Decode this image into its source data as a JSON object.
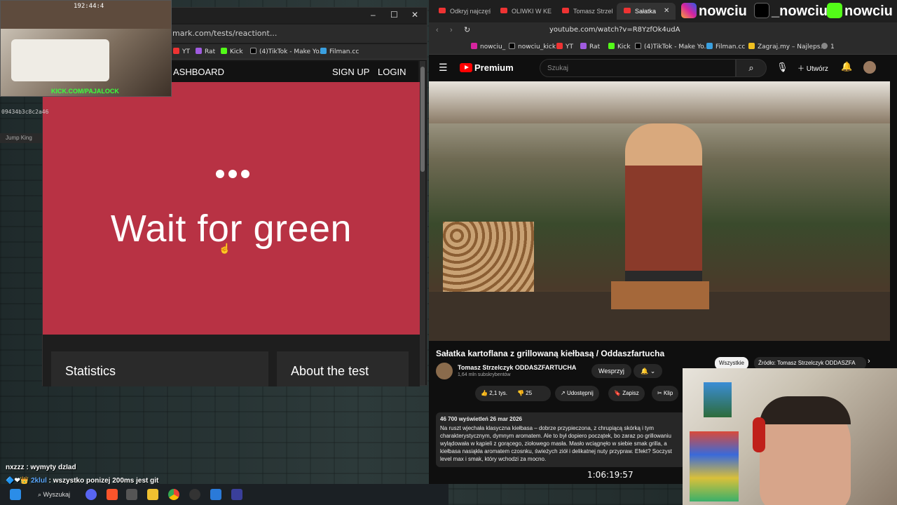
{
  "left_browser": {
    "url": "mark.com/tests/reactiont...",
    "bookmarks": [
      "YT",
      "Rat",
      "Kick",
      "(4)TikTok - Make Yo...",
      "Filman.cc"
    ],
    "nav": {
      "dashboard": "ASHBOARD",
      "signup": "SIGN UP",
      "login": "LOGIN"
    },
    "test": {
      "message": "Wait for green",
      "bg_color": "#b83244"
    },
    "cards": {
      "statistics": "Statistics",
      "about": "About the test"
    }
  },
  "stream_overlay": {
    "time": "192:44:4",
    "kick_label": "KICK.COM/PAJALOCK",
    "hash": "09434b3c8c2a46",
    "jump_king": "Jump King"
  },
  "right_browser": {
    "tabs": [
      "Odkryj najczęśc",
      "OLIWKI W KE",
      "Tomasz Strzel",
      "Sałatka"
    ],
    "social": {
      "instagram": "nowciu",
      "x": "_nowciu",
      "kick": "nowciu"
    },
    "url": "youtube.com/watch?v=R8YzfOk4udA",
    "bookmarks": [
      "nowciu_",
      "nowciu_kick",
      "YT",
      "Rat",
      "Kick",
      "(4)TikTok - Make Yo...",
      "Filman.cc",
      "Zagraj.my – Najleps...",
      "1"
    ],
    "youtube": {
      "logo": "Premium",
      "search_placeholder": "Szukaj",
      "create": "Utwórz",
      "video_title": "Sałatka kartoflana z grillowaną kiełbasą / Oddaszfartucha",
      "channel": "Tomasz Strzelczyk ODDASZFARTUCHA",
      "subscribers": "1,64 mln subskrybentów",
      "support": "Wesprzyj",
      "chips": [
        "Wszystkie",
        "Źródło: Tomasz Strzelczyk ODDASZFA"
      ],
      "likes": "2,1 tys.",
      "dislikes": "25",
      "share": "Udostępnij",
      "save": "Zapisz",
      "clip": "Klip",
      "views_date": "46 700 wyświetleń  26 mar 2026",
      "description": "Na ruszt wjechała klasyczna kiełbasa – dobrze przypieczona, z chrupiącą skórką i tym charakterystycznym, dymnym aromatem. Ale to był dopiero początek, bo zaraz po grillowaniu wylądowała w kąpieli z gorącego, ziołowego masła. Masło wciągnęło w siebie smak grilla, a kiełbasa nasiąkła aromatem czosnku, świeżych ziół i delikatnej nuty przypraw. Efekt? Soczyst level max i smak, który wchodzi za mocno.",
      "timer": "1:06:19:57"
    }
  },
  "chat": [
    {
      "user": "nxzzz",
      "message": ": wymyty dzIad"
    },
    {
      "user": "2klul",
      "message": ": wszystko ponizej 200ms jest git"
    }
  ],
  "taskbar": {
    "search": "Wyszukaj"
  }
}
